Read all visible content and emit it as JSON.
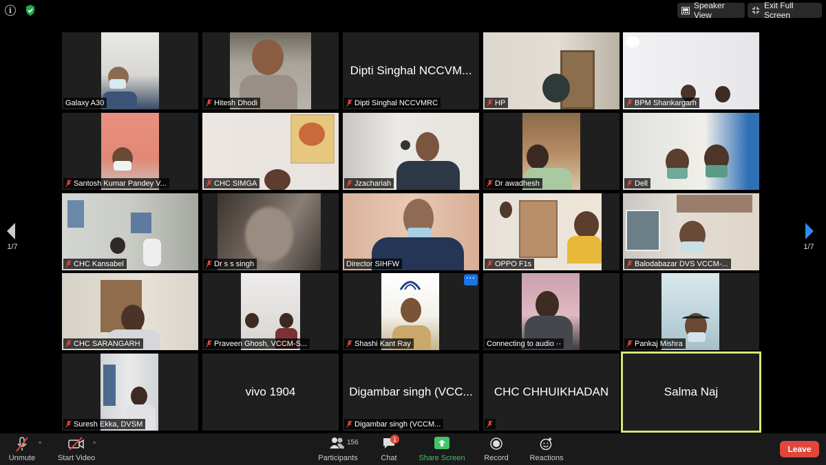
{
  "window": {
    "speaker_view_label": "Speaker View",
    "exit_fullscreen_label": "Exit Full Screen",
    "page_indicator": "1/7",
    "accent_color": "#d8e673"
  },
  "participants": [
    {
      "name": "Galaxy A30",
      "muted": false
    },
    {
      "name": "Hitesh Dhodi",
      "muted": true
    },
    {
      "name": "Dipti Singhal NCCVMRC",
      "display_name": "Dipti Singhal NCCVM...",
      "muted": true
    },
    {
      "name": "HP",
      "muted": true
    },
    {
      "name": "BPM Shankargarh",
      "muted": true
    },
    {
      "name": "Santosh Kumar Pandey V...",
      "muted": true
    },
    {
      "name": "CHC SIMGA",
      "muted": true
    },
    {
      "name": "Jzachariah",
      "muted": true
    },
    {
      "name": "Dr awadhesh",
      "muted": true
    },
    {
      "name": "Dell",
      "muted": true
    },
    {
      "name": "CHC Kansabel",
      "muted": true
    },
    {
      "name": "Dr s s singh",
      "muted": true
    },
    {
      "name": "Director SIHFW",
      "muted": false
    },
    {
      "name": "OPPO F1s",
      "muted": true
    },
    {
      "name": "Balodabazar DVS VCCM-...",
      "muted": true
    },
    {
      "name": "CHC SARANGARH",
      "muted": true
    },
    {
      "name": "Praveen Ghosh, VCCM-S...",
      "muted": true
    },
    {
      "name": "Shashi Kant Ray",
      "muted": true
    },
    {
      "name": "Connecting to audio ··",
      "muted": false
    },
    {
      "name": "Pankaj Mishra",
      "muted": true
    },
    {
      "name": "Suresh Ekka, DVSM",
      "muted": true
    },
    {
      "name": "",
      "display_name": "vivo 1904",
      "muted": false
    },
    {
      "name": "Digambar singh (VCCM...",
      "display_name": "Digambar singh (VCC...",
      "muted": true
    },
    {
      "name": "",
      "display_name": "CHC CHHUIKHADAN",
      "muted": true
    },
    {
      "name": "",
      "display_name": "Salma Naj",
      "muted": false
    }
  ],
  "toolbar": {
    "unmute": "Unmute",
    "start_video": "Start Video",
    "participants": "Participants",
    "participant_count": "156",
    "chat": "Chat",
    "chat_badge": "1",
    "share_screen": "Share Screen",
    "record": "Record",
    "reactions": "Reactions",
    "leave": "Leave",
    "share_color": "#3fc763",
    "leave_color": "#e0463b"
  }
}
